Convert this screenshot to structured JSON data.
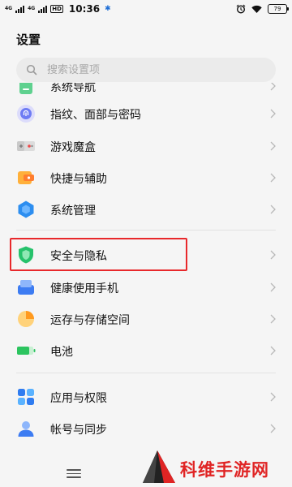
{
  "status_bar": {
    "network_1": "4G",
    "network_2": "4G",
    "hd_label": "HD",
    "time": "10:36",
    "battery": "79"
  },
  "header": {
    "title": "设置"
  },
  "search": {
    "placeholder": "搜索设置项",
    "value": ""
  },
  "settings_list": [
    {
      "label": "系统导航",
      "icon": "navigation-icon"
    },
    {
      "label": "指纹、面部与密码",
      "icon": "fingerprint-icon"
    },
    {
      "label": "游戏魔盒",
      "icon": "game-box-icon"
    },
    {
      "label": "快捷与辅助",
      "icon": "shortcut-icon"
    },
    {
      "label": "系统管理",
      "icon": "system-management-icon"
    },
    {
      "label": "安全与隐私",
      "icon": "shield-icon",
      "highlighted": true
    },
    {
      "label": "健康使用手机",
      "icon": "health-phone-icon"
    },
    {
      "label": "运存与存储空间",
      "icon": "storage-pie-icon"
    },
    {
      "label": "电池",
      "icon": "battery-icon"
    },
    {
      "label": "应用与权限",
      "icon": "apps-grid-icon"
    },
    {
      "label": "帐号与同步",
      "icon": "account-icon"
    }
  ],
  "watermark": {
    "text": "科维手游网"
  },
  "colors": {
    "highlight_border": "#e8282b",
    "watermark_red": "#e02424",
    "accent_blue": "#3d7cf2",
    "shield_green": "#27c26c"
  }
}
